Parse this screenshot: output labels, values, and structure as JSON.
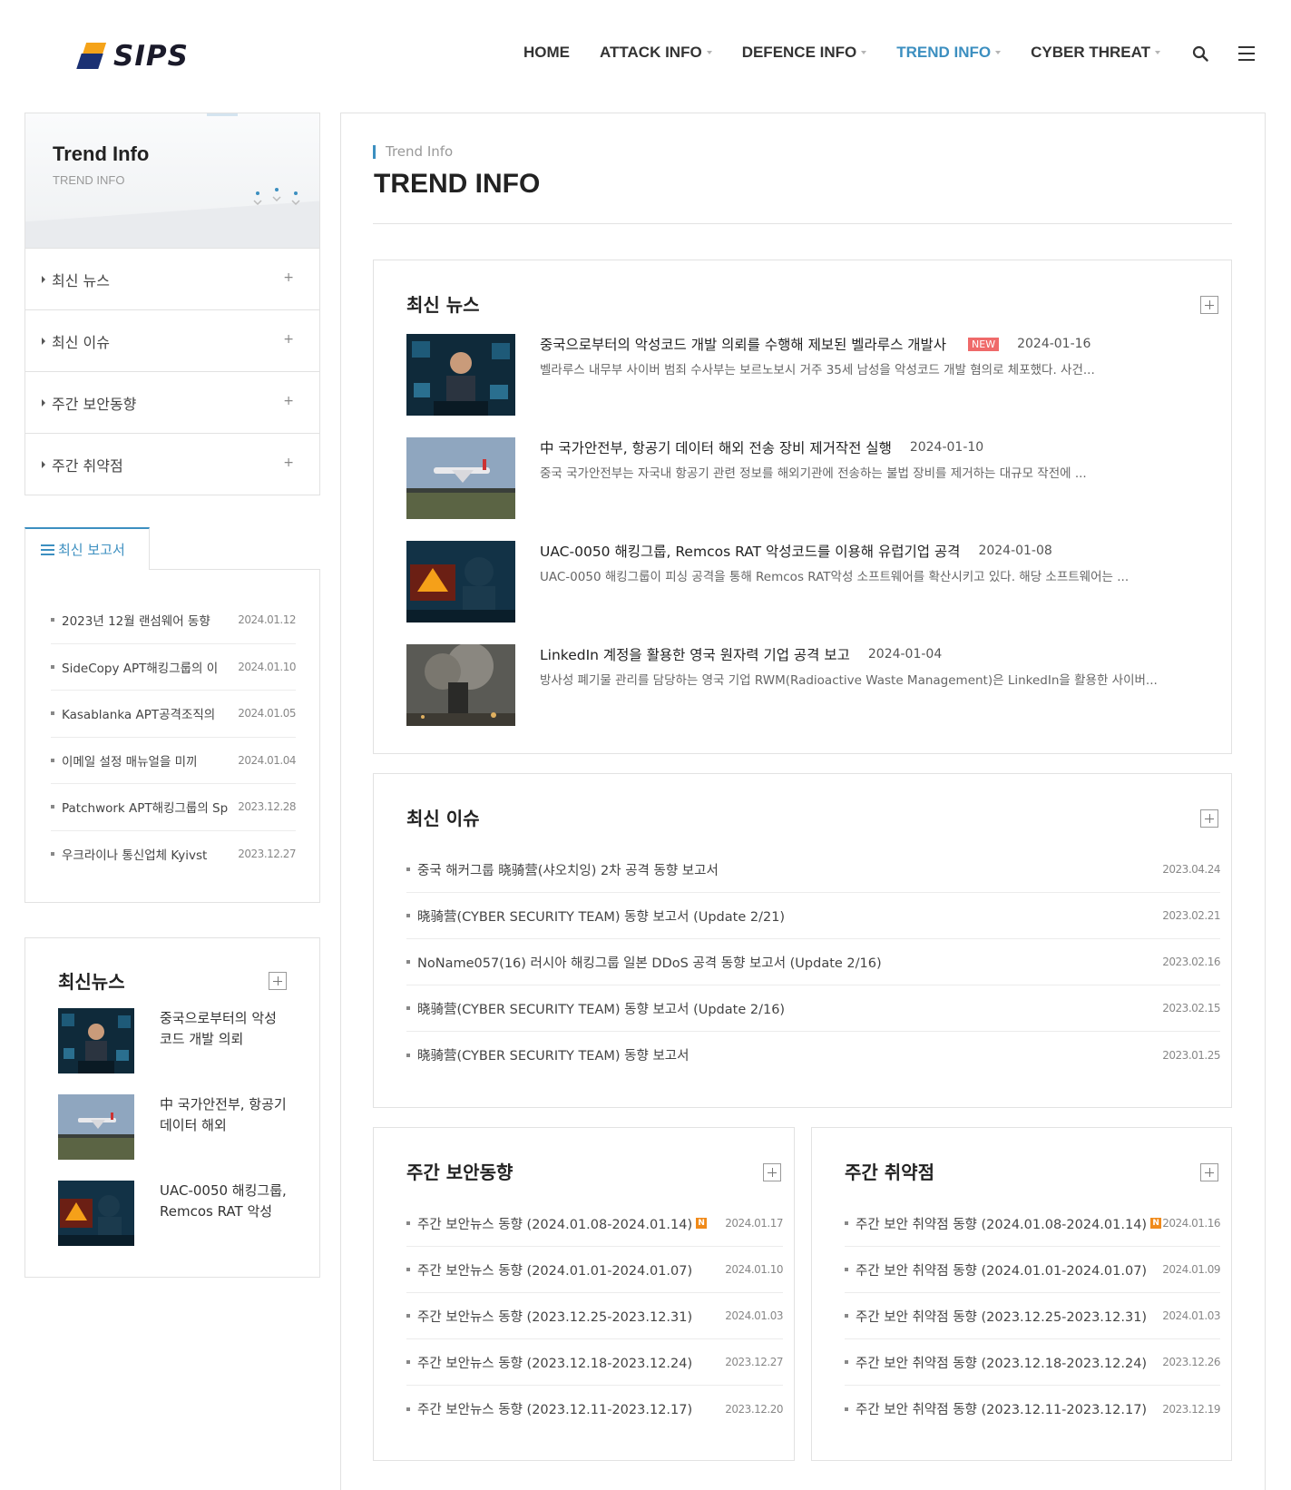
{
  "brand": {
    "name": "SIPS"
  },
  "nav": {
    "items": [
      {
        "label": "HOME",
        "dropdown": false,
        "active": false
      },
      {
        "label": "ATTACK INFO",
        "dropdown": true,
        "active": false
      },
      {
        "label": "DEFENCE INFO",
        "dropdown": true,
        "active": false
      },
      {
        "label": "TREND INFO",
        "dropdown": true,
        "active": true
      },
      {
        "label": "CYBER THREAT",
        "dropdown": true,
        "active": false
      }
    ],
    "icons": [
      "search-icon",
      "hamburger-menu-icon"
    ]
  },
  "sidebar": {
    "title": "Trend Info",
    "subtitle": "TREND INFO",
    "items": [
      {
        "label": "최신 뉴스",
        "plus": "+"
      },
      {
        "label": "최신 이슈",
        "plus": "+"
      },
      {
        "label": "주간 보안동향",
        "plus": "+"
      },
      {
        "label": "주간 취약점",
        "plus": "+"
      }
    ]
  },
  "reports": {
    "tab_label": "최신 보고서",
    "items": [
      {
        "title": "2023년 12월 랜섬웨어 동향",
        "date": "2024.01.12"
      },
      {
        "title": "SideCopy APT해킹그룹의 이",
        "date": "2024.01.10"
      },
      {
        "title": "Kasablanka APT공격조직의",
        "date": "2024.01.05"
      },
      {
        "title": "이메일 설정 매뉴얼을 미끼",
        "date": "2024.01.04"
      },
      {
        "title": "Patchwork APT해킹그룹의 Sp",
        "date": "2023.12.28"
      },
      {
        "title": "우크라이나 통신업체 Kyivst",
        "date": "2023.12.27"
      }
    ]
  },
  "side_news": {
    "title": "최신뉴스",
    "items": [
      {
        "text": "중국으로부터의 악성코드 개발 의뢰"
      },
      {
        "text": "中 국가안전부, 항공기 데이터 해외"
      },
      {
        "text": "UAC-0050 해킹그룹, Remcos RAT 악성"
      }
    ]
  },
  "main": {
    "breadcrumb": "Trend Info",
    "title": "TREND INFO",
    "news": {
      "title": "최신 뉴스",
      "items": [
        {
          "title": "중국으로부터의 악성코드 개발 의뢰를 수행해 제보된 벨라루스 개발사",
          "badge": "NEW",
          "date": "2024-01-16",
          "desc": "벨라루스 내무부 사이버 범죄 수사부는 보르노보시 거주 35세 남성을 악성코드 개발 혐의로 체포했다. 사건..."
        },
        {
          "title": "中 국가안전부, 항공기 데이터 해외 전송 장비 제거작전 실행",
          "badge": "",
          "date": "2024-01-10",
          "desc": "중국 국가안전부는 자국내 항공기 관련 정보를 해외기관에 전송하는 불법 장비를 제거하는 대규모 작전에 ..."
        },
        {
          "title": "UAC-0050 해킹그룹, Remcos RAT 악성코드를 이용해 유럽기업 공격",
          "badge": "",
          "date": "2024-01-08",
          "desc": "UAC-0050 해킹그룹이 피싱 공격을 통해 Remcos RAT악성 소프트웨어를 확산시키고 있다. 해당 소프트웨어는 ..."
        },
        {
          "title": "LinkedIn 계정을 활용한 영국 원자력 기업 공격 보고",
          "badge": "",
          "date": "2024-01-04",
          "desc": "방사성 폐기물 관리를 담당하는 영국 기업 RWM(Radioactive Waste Management)은 LinkedIn을 활용한 사이버..."
        }
      ]
    },
    "issues": {
      "title": "최신 이슈",
      "items": [
        {
          "title": "중국 해커그룹 晓骑营(샤오치잉) 2차 공격 동향 보고서",
          "date": "2023.04.24"
        },
        {
          "title": "晓骑营(CYBER SECURITY TEAM) 동향 보고서 (Update 2/21)",
          "date": "2023.02.21"
        },
        {
          "title": "NoName057(16) 러시아 해킹그룹 일본 DDoS 공격 동향 보고서 (Update 2/16)",
          "date": "2023.02.16"
        },
        {
          "title": "晓骑营(CYBER SECURITY TEAM) 동향 보고서 (Update 2/16)",
          "date": "2023.02.15"
        },
        {
          "title": "晓骑营(CYBER SECURITY TEAM) 동향 보고서",
          "date": "2023.01.25"
        }
      ]
    },
    "weekly_security": {
      "title": "주간 보안동향",
      "items": [
        {
          "title": "주간 보안뉴스 동향 (2024.01.08-2024.01.14)",
          "badge": "N",
          "date": "2024.01.17"
        },
        {
          "title": "주간 보안뉴스 동향 (2024.01.01-2024.01.07)",
          "badge": "",
          "date": "2024.01.10"
        },
        {
          "title": "주간 보안뉴스 동향 (2023.12.25-2023.12.31)",
          "badge": "",
          "date": "2024.01.03"
        },
        {
          "title": "주간 보안뉴스 동향 (2023.12.18-2023.12.24)",
          "badge": "",
          "date": "2023.12.27"
        },
        {
          "title": "주간 보안뉴스 동향 (2023.12.11-2023.12.17)",
          "badge": "",
          "date": "2023.12.20"
        }
      ]
    },
    "weekly_vuln": {
      "title": "주간 취약점",
      "items": [
        {
          "title": "주간 보안 취약점 동향 (2024.01.08-2024.01.14)",
          "badge": "N",
          "date": "2024.01.16"
        },
        {
          "title": "주간 보안 취약점 동향 (2024.01.01-2024.01.07)",
          "badge": "",
          "date": "2024.01.09"
        },
        {
          "title": "주간 보안 취약점 동향 (2023.12.25-2023.12.31)",
          "badge": "",
          "date": "2024.01.03"
        },
        {
          "title": "주간 보안 취약점 동향 (2023.12.18-2023.12.24)",
          "badge": "",
          "date": "2023.12.26"
        },
        {
          "title": "주간 보안 취약점 동향 (2023.12.11-2023.12.17)",
          "badge": "",
          "date": "2023.12.19"
        }
      ]
    }
  },
  "colors": {
    "accent": "#3c8fc0",
    "badge_new": "#ef6a6a",
    "badge_n": "#f08a1a",
    "logo_orange": "#f5a319",
    "logo_navy": "#1b3173"
  }
}
